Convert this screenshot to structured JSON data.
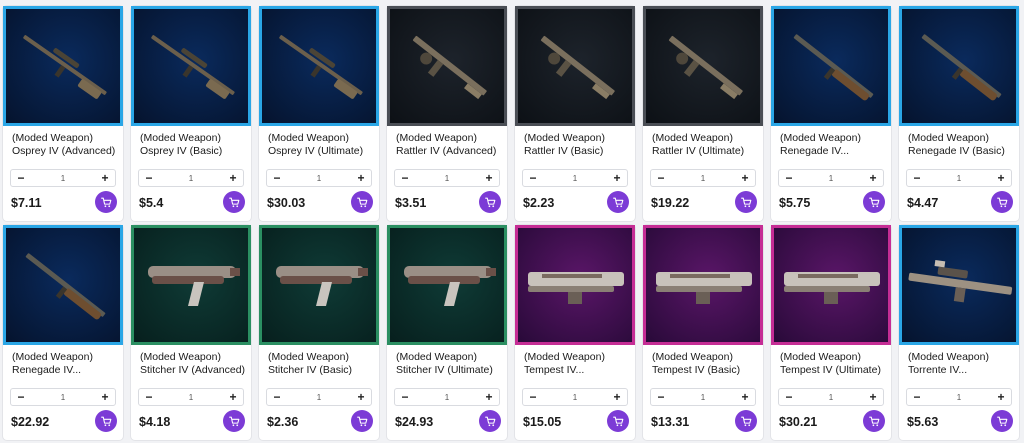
{
  "icons": {
    "decrement": "minus-icon",
    "increment": "plus-icon",
    "cart": "cart-icon"
  },
  "colors": {
    "accent_purple": "#7c3bd6",
    "border_blue": "#2aa6e6",
    "border_dark": "#4a4e55",
    "border_green": "#2b8f62",
    "border_magenta": "#c52d95"
  },
  "products": [
    {
      "tag": "(Moded Weapon)",
      "name": "Osprey IV (Advanced)",
      "qty": "1",
      "price": "$7.11",
      "theme": "blue",
      "weapon": "sniper"
    },
    {
      "tag": "(Moded Weapon)",
      "name": "Osprey IV (Basic)",
      "qty": "1",
      "price": "$5.4",
      "theme": "blue",
      "weapon": "sniper"
    },
    {
      "tag": "(Moded Weapon)",
      "name": "Osprey IV (Ultimate)",
      "qty": "1",
      "price": "$30.03",
      "theme": "blue",
      "weapon": "sniper"
    },
    {
      "tag": "(Moded Weapon)",
      "name": "Rattler IV (Advanced)",
      "qty": "1",
      "price": "$3.51",
      "theme": "dark",
      "weapon": "smg"
    },
    {
      "tag": "(Moded Weapon)",
      "name": "Rattler IV (Basic)",
      "qty": "1",
      "price": "$2.23",
      "theme": "dark",
      "weapon": "smg"
    },
    {
      "tag": "(Moded Weapon)",
      "name": "Rattler IV (Ultimate)",
      "qty": "1",
      "price": "$19.22",
      "theme": "dark",
      "weapon": "smg"
    },
    {
      "tag": "(Moded Weapon)",
      "name": "Renegade IV...",
      "qty": "1",
      "price": "$5.75",
      "theme": "blue",
      "weapon": "rifle"
    },
    {
      "tag": "(Moded Weapon)",
      "name": "Renegade IV (Basic)",
      "qty": "1",
      "price": "$4.47",
      "theme": "blue",
      "weapon": "rifle"
    },
    {
      "tag": "(Moded Weapon)",
      "name": "Renegade IV...",
      "qty": "1",
      "price": "$22.92",
      "theme": "blue",
      "weapon": "rifle"
    },
    {
      "tag": "(Moded Weapon)",
      "name": "Stitcher IV (Advanced)",
      "qty": "1",
      "price": "$4.18",
      "theme": "green",
      "weapon": "pistol"
    },
    {
      "tag": "(Moded Weapon)",
      "name": "Stitcher IV (Basic)",
      "qty": "1",
      "price": "$2.36",
      "theme": "green",
      "weapon": "pistol"
    },
    {
      "tag": "(Moded Weapon)",
      "name": "Stitcher IV (Ultimate)",
      "qty": "1",
      "price": "$24.93",
      "theme": "green",
      "weapon": "pistol"
    },
    {
      "tag": "(Moded Weapon)",
      "name": "Tempest IV...",
      "qty": "1",
      "price": "$15.05",
      "theme": "magenta",
      "weapon": "launcher"
    },
    {
      "tag": "(Moded Weapon)",
      "name": "Tempest IV (Basic)",
      "qty": "1",
      "price": "$13.31",
      "theme": "magenta",
      "weapon": "launcher"
    },
    {
      "tag": "(Moded Weapon)",
      "name": "Tempest IV (Ultimate)",
      "qty": "1",
      "price": "$30.21",
      "theme": "magenta",
      "weapon": "launcher"
    },
    {
      "tag": "(Moded Weapon)",
      "name": "Torrente IV...",
      "qty": "1",
      "price": "$5.63",
      "theme": "blue",
      "weapon": "lmg"
    }
  ]
}
